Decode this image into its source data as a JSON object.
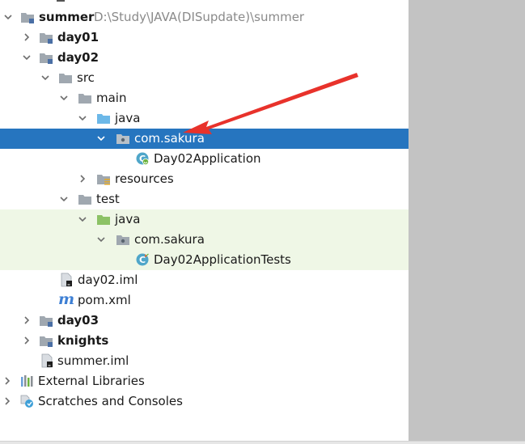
{
  "project_tree": {
    "root": {
      "name": "summer",
      "path": "D:\\Study\\JAVA(DISupdate)\\summer"
    },
    "items": [
      {
        "label": "day01"
      },
      {
        "label": "day02"
      },
      {
        "label": "src"
      },
      {
        "label": "main"
      },
      {
        "label": "java"
      },
      {
        "label": "com.sakura"
      },
      {
        "label": "Day02Application"
      },
      {
        "label": "resources"
      },
      {
        "label": "test"
      },
      {
        "label": "java"
      },
      {
        "label": "com.sakura"
      },
      {
        "label": "Day02ApplicationTests"
      },
      {
        "label": "day02.iml"
      },
      {
        "label": "pom.xml"
      },
      {
        "label": "day03"
      },
      {
        "label": "knights"
      },
      {
        "label": "summer.iml"
      },
      {
        "label": "External Libraries"
      },
      {
        "label": "Scratches and Consoles"
      }
    ],
    "selected_item": "com.sakura"
  },
  "icon_glyphs": {
    "pom_m": "m"
  },
  "colors": {
    "selection": "#2675bf",
    "test_root_bg": "#eff7e6",
    "annotation_arrow": "#e8322b",
    "folder": "#a0a8b0",
    "source_root_folder": "#6cb8e8",
    "test_root_folder": "#8cc265"
  }
}
